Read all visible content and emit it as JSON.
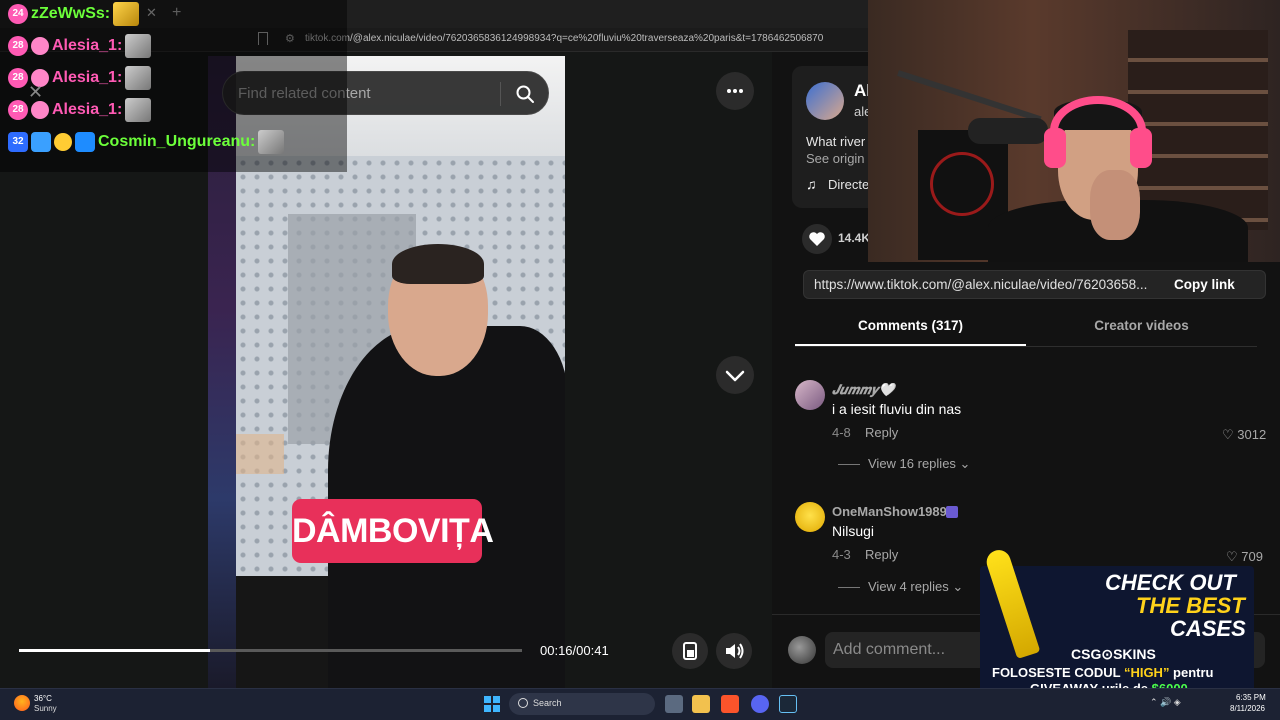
{
  "browser": {
    "url": "tiktok.com/@alex.niculae/video/7620365836124998934?q=ce%20fluviu%20traverseaza%20paris&t=1786462506870",
    "close_glyph": "✕",
    "new_tab_glyph": "+"
  },
  "chat": {
    "messages": [
      {
        "badge": "24",
        "user": "zZeWwSs:",
        "user_color": "#6cff3a"
      },
      {
        "badge": "28",
        "user": "Alesia_1:",
        "user_color": "#ff5ab4"
      },
      {
        "badge": "28",
        "user": "Alesia_1:",
        "user_color": "#ff5ab4"
      },
      {
        "badge": "28",
        "user": "Alesia_1:",
        "user_color": "#ff5ab4"
      },
      {
        "badge": "32",
        "user": "Cosmin_Ungureanu:",
        "user_color": "#6cff3a"
      }
    ]
  },
  "video": {
    "search_placeholder": "Find related content",
    "caption": "DÂMBOVIȚA",
    "time": "00:16/00:41",
    "progress": 0.38
  },
  "creator": {
    "name": "Al",
    "handle": "ale",
    "description": "What river",
    "see_original": "See origin",
    "music": "Directe",
    "music_icon": "♫",
    "likes": "14.4K"
  },
  "share": {
    "link": "https://www.tiktok.com/@alex.niculae/video/76203658...",
    "copy_label": "Copy link"
  },
  "tabs": {
    "comments": "Comments (317)",
    "creator_videos": "Creator videos"
  },
  "comments": [
    {
      "user": "𝑱𝒖𝒎𝒎𝒚🤍",
      "text": "i a iesit fluviu din nas",
      "date": "4-8",
      "reply": "Reply",
      "likes": "3012",
      "view_replies": "View 16 replies"
    },
    {
      "user": "OneManShow1989",
      "text": "Nilsugi",
      "date": "4-3",
      "reply": "Reply",
      "likes": "709",
      "view_replies": "View 4 replies"
    }
  ],
  "comment_input": {
    "placeholder": "Add comment..."
  },
  "ad": {
    "line1": "CHECK OUT",
    "line2": "THE BEST",
    "line3": "CASES",
    "brand": "CSG⊙SKINS",
    "promo_a": "FOLOSESTE CODUL ",
    "promo_code": "“HIGH”",
    "promo_b": " pentru",
    "promo_c": "GIVEAWAY-urile de ",
    "promo_amount": "$6000"
  },
  "taskbar": {
    "temp": "36°C",
    "weather": "Sunny",
    "search": "Search",
    "time": "6:35 PM",
    "date": "8/11/2026"
  },
  "colors": {
    "accent_pink": "#e8305a",
    "headphones": "#ff4d8a"
  }
}
